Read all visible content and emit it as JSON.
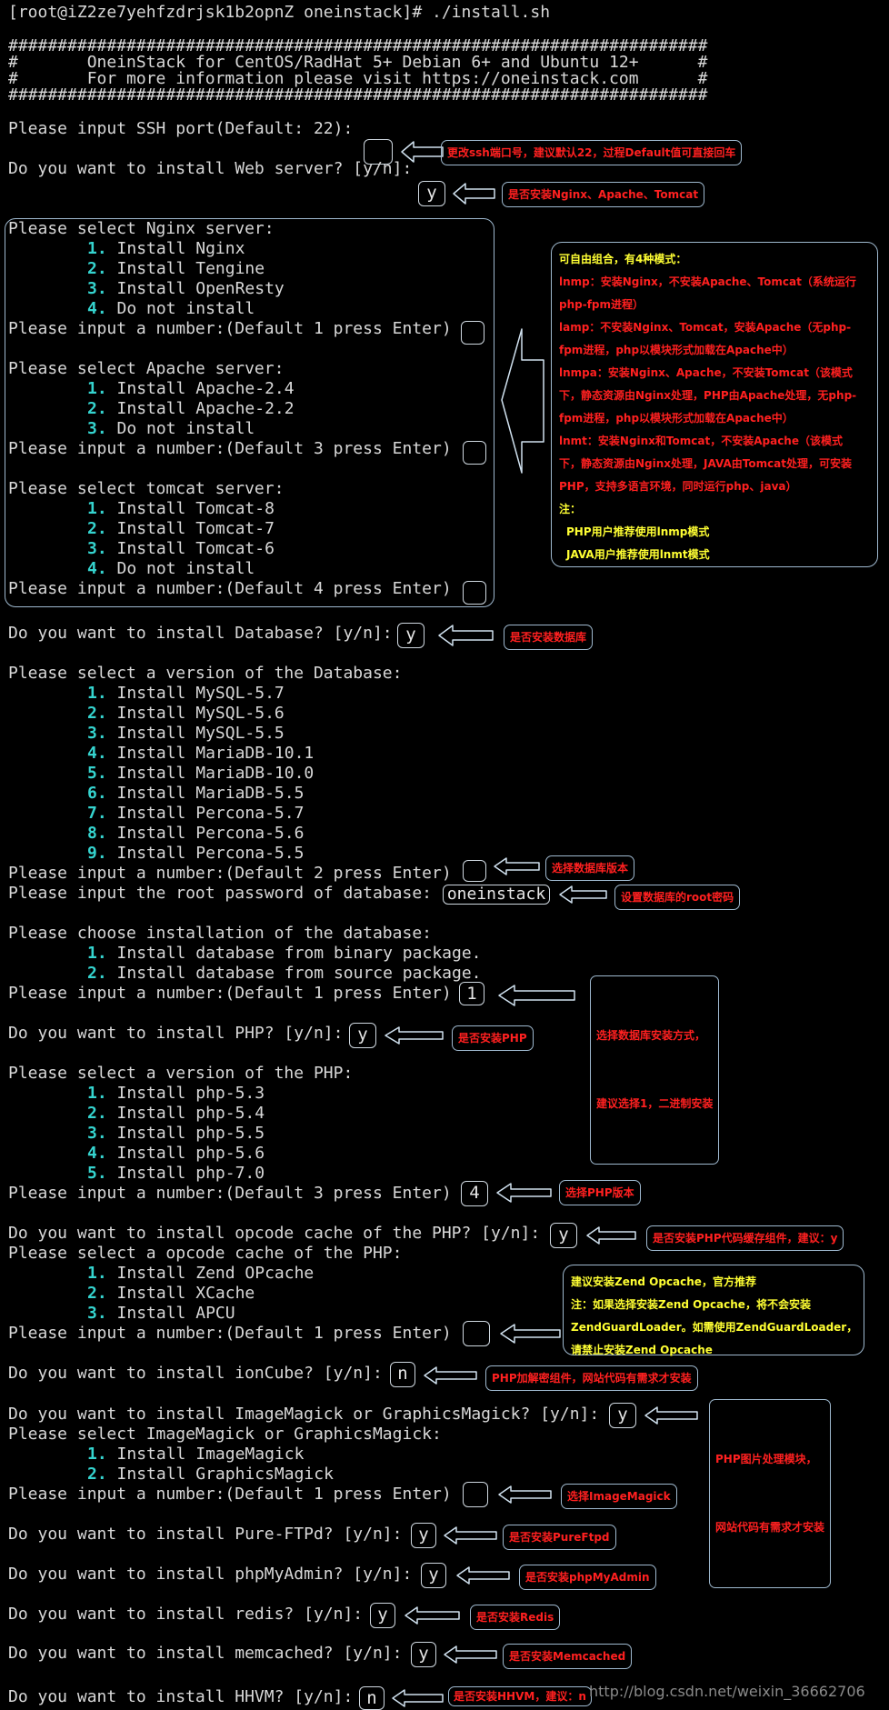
{
  "terminal": {
    "prompt_cmd": "[root@iZ2ze7yehfzdrjsk1b2opnZ oneinstack]# ./install.sh",
    "banner": {
      "border": "#######################################################################",
      "line1": "#       OneinStack for CentOS/RadHat 5+ Debian 6+ and Ubuntu 12+      #",
      "line2": "#       For more information please visit https://oneinstack.com      #"
    },
    "ssh_prompt": "Please input SSH port(Default: 22):",
    "ssh_value": "",
    "web_prompt": "Do you want to install Web server? [y/n]:",
    "web_value": "y",
    "nginx": {
      "title": "Please select Nginx server:",
      "options": [
        "Install Nginx",
        "Install Tengine",
        "Install OpenResty",
        "Do not install"
      ],
      "input_prompt": "Please input a number:(Default 1 press Enter)",
      "value": ""
    },
    "apache": {
      "title": "Please select Apache server:",
      "options": [
        "Install Apache-2.4",
        "Install Apache-2.2",
        "Do not install"
      ],
      "input_prompt": "Please input a number:(Default 3 press Enter)",
      "value": ""
    },
    "tomcat": {
      "title": "Please select tomcat server:",
      "options": [
        "Install Tomcat-8",
        "Install Tomcat-7",
        "Install Tomcat-6",
        "Do not install"
      ],
      "input_prompt": "Please input a number:(Default 4 press Enter)",
      "value": ""
    },
    "db_prompt": "Do you want to install Database? [y/n]:",
    "db_value": "y",
    "db_version": {
      "title": "Please select a version of the Database:",
      "options": [
        "Install MySQL-5.7",
        "Install MySQL-5.6",
        "Install MySQL-5.5",
        "Install MariaDB-10.1",
        "Install MariaDB-10.0",
        "Install MariaDB-5.5",
        "Install Percona-5.7",
        "Install Percona-5.6",
        "Install Percona-5.5"
      ],
      "input_prompt": "Please input a number:(Default 2 press Enter)",
      "value": ""
    },
    "root_pw_prompt": "Please input the root password of database:",
    "root_pw_value": "oneinstack",
    "db_install": {
      "title": "Please choose installation of the database:",
      "options": [
        "Install database from binary package.",
        "Install database from source package."
      ],
      "input_prompt": "Please input a number:(Default 1 press Enter)",
      "value": "1"
    },
    "php_prompt": "Do you want to install PHP? [y/n]:",
    "php_value": "y",
    "php_version": {
      "title": "Please select a version of the PHP:",
      "options": [
        "Install php-5.3",
        "Install php-5.4",
        "Install php-5.5",
        "Install php-5.6",
        "Install php-7.0"
      ],
      "input_prompt": "Please input a number:(Default 3 press Enter)",
      "value": "4"
    },
    "opcode_prompt": "Do you want to install opcode cache of the PHP? [y/n]:",
    "opcode_value": "y",
    "opcode_select": {
      "title": "Please select a opcode cache of the PHP:",
      "options": [
        "Install Zend OPcache",
        "Install XCache",
        "Install APCU"
      ],
      "input_prompt": "Please input a number:(Default 1 press Enter)",
      "value": ""
    },
    "ioncube_prompt": "Do you want to install ionCube? [y/n]:",
    "ioncube_value": "n",
    "imagick_prompt": "Do you want to install ImageMagick or GraphicsMagick? [y/n]:",
    "imagick_value": "y",
    "imagick_select": {
      "title": "Please select ImageMagick or GraphicsMagick:",
      "options": [
        "Install ImageMagick",
        "Install GraphicsMagick"
      ],
      "input_prompt": "Please input a number:(Default 1 press Enter)",
      "value": ""
    },
    "ftp_prompt": "Do you want to install Pure-FTPd? [y/n]:",
    "ftp_value": "y",
    "pma_prompt": "Do you want to install phpMyAdmin? [y/n]:",
    "pma_value": "y",
    "redis_prompt": "Do you want to install redis? [y/n]:",
    "redis_value": "y",
    "memcached_prompt": "Do you want to install memcached? [y/n]:",
    "memcached_value": "y",
    "hhvm_prompt": "Do you want to install HHVM? [y/n]:",
    "hhvm_value": "n"
  },
  "annotations": {
    "ssh": "更改ssh端口号，建议默认22，过程Default值可直接回车",
    "web": "是否安装Nginx、Apache、Tomcat",
    "combo": {
      "title": "可自由组合，有4种模式：",
      "lines": [
        "lnmp：安装Nginx，不安装Apache、Tomcat（系统运行",
        "php-fpm进程）",
        "lamp：不安装Nginx、Tomcat，安装Apache（无php-",
        "fpm进程，php以模块形式加载在Apache中）",
        "lnmpa：安装Nginx、Apache，不安装Tomcat（该模式",
        "下，静态资源由Nginx处理，PHP由Apache处理，无php-",
        "fpm进程，php以模块形式加载在Apache中）",
        "lnmt：安装Nginx和Tomcat，不安装Apache（该模式",
        "下，静态资源由Nginx处理，JAVA由Tomcat处理，可安装",
        "PHP，支持多语言环境，同时运行php、java）"
      ],
      "note_label": "注：",
      "note_lines": [
        "PHP用户推荐使用lnmp模式",
        "JAVA用户推荐使用lnmt模式"
      ]
    },
    "db": "是否安装数据库",
    "db_version": "选择数据库版本",
    "root_pw": "设置数据库的root密码",
    "db_install_1": "选择数据库安装方式，",
    "db_install_2": "建议选择1，二进制安装",
    "php": "是否安装PHP",
    "php_version": "选择PHP版本",
    "opcode": "是否安装PHP代码缓存组件，建议：y",
    "opcode_select": [
      "建议安装Zend Opcache，官方推荐",
      "注：如果选择安装Zend Opcache，将不会安装",
      "ZendGuardLoader。如需使用ZendGuardLoader，",
      "请禁止安装Zend Opcache"
    ],
    "ioncube": "PHP加解密组件，网站代码有需求才安装",
    "imagick_1": "PHP图片处理模块，",
    "imagick_2": "网站代码有需求才安装",
    "imagick_select": "选择ImageMagick",
    "ftp": "是否安装PureFtpd",
    "pma": "是否安装phpMyAdmin",
    "redis": "是否安装Redis",
    "memcached": "是否安装Memcached",
    "hhvm": "是否安装HHVM，建议：n"
  },
  "watermark": "http://blog.csdn.net/weixin_36662706",
  "colors": {
    "background": "#000000",
    "text": "#d8d8d8",
    "option_number": "#35d4cf",
    "annotation_text": "#ff2020",
    "annotation_highlight": "#ffff33",
    "border": "#9fb9cf"
  }
}
